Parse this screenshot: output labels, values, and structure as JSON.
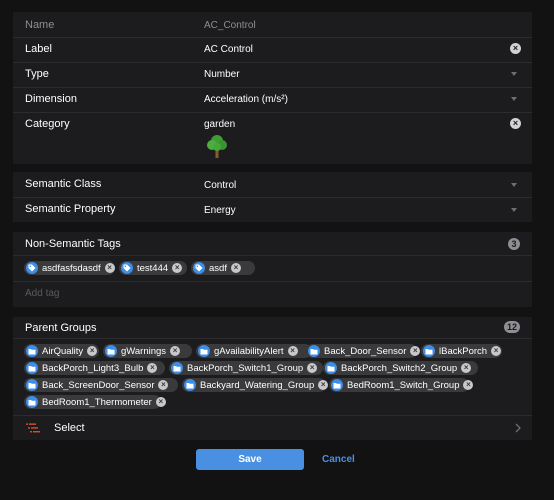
{
  "fields": {
    "name": {
      "label": "Name",
      "value": "AC_Control"
    },
    "label": {
      "label": "Label",
      "value": "AC Control"
    },
    "type": {
      "label": "Type",
      "value": "Number"
    },
    "dimension": {
      "label": "Dimension",
      "value": "Acceleration (m/s²)"
    },
    "category": {
      "label": "Category",
      "value": "garden",
      "icon": "tree-icon"
    }
  },
  "semantics": {
    "class": {
      "label": "Semantic Class",
      "value": "Control"
    },
    "property": {
      "label": "Semantic Property",
      "value": "Energy"
    }
  },
  "tags": {
    "title": "Non-Semantic Tags",
    "count": "3",
    "items": [
      "asdfasfsdasdf",
      "test444",
      "asdf"
    ],
    "placeholder": "Add tag"
  },
  "groups": {
    "title": "Parent Groups",
    "count": "12",
    "items": [
      "AirQuality",
      "gWarnings",
      "gAvailabilityAlert",
      "Back_Door_Sensor",
      "lBackPorch",
      "BackPorch_Light3_Bulb",
      "BackPorch_Switch1_Group",
      "BackPorch_Switch2_Group",
      "Back_ScreenDoor_Sensor",
      "Backyard_Watering_Group",
      "BedRoom1_Switch_Group",
      "BedRoom1_Thermometer"
    ],
    "select_label": "Select"
  },
  "actions": {
    "save": "Save",
    "cancel": "Cancel"
  },
  "colors": {
    "accent": "#4a90e2",
    "chip_icon": "#3d8ee6",
    "select_icon": "#e8542e"
  }
}
